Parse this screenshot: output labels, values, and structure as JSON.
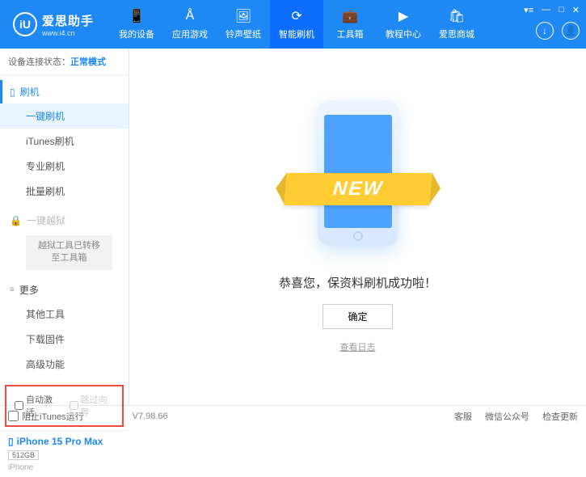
{
  "header": {
    "logo_letter": "iU",
    "title": "爱思助手",
    "url": "www.i4.cn",
    "tabs": [
      {
        "label": "我的设备"
      },
      {
        "label": "应用游戏"
      },
      {
        "label": "铃声壁纸"
      },
      {
        "label": "智能刷机"
      },
      {
        "label": "工具箱"
      },
      {
        "label": "教程中心"
      },
      {
        "label": "爱思商城"
      }
    ]
  },
  "sidebar": {
    "status_label": "设备连接状态：",
    "status_mode": "正常模式",
    "flash": {
      "header": "刷机",
      "items": [
        "一键刷机",
        "iTunes刷机",
        "专业刷机",
        "批量刷机"
      ]
    },
    "jailbreak": {
      "header": "一键越狱",
      "note": "越狱工具已转移至工具箱"
    },
    "more": {
      "header": "更多",
      "items": [
        "其他工具",
        "下载固件",
        "高级功能"
      ]
    },
    "checkboxes": {
      "auto_activate": "自动激活",
      "skip_guide": "跳过向导"
    },
    "device": {
      "name": "iPhone 15 Pro Max",
      "capacity": "512GB",
      "type": "iPhone"
    }
  },
  "main": {
    "banner": "NEW",
    "success": "恭喜您，保资料刷机成功啦！",
    "ok": "确定",
    "log_link": "查看日志"
  },
  "footer": {
    "block_itunes": "阻止iTunes运行",
    "version": "V7.98.66",
    "links": [
      "客服",
      "微信公众号",
      "检查更新"
    ]
  }
}
